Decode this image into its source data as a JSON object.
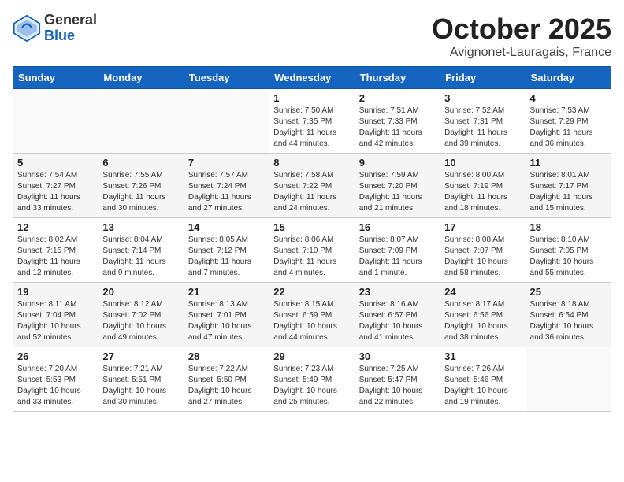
{
  "header": {
    "logo_general": "General",
    "logo_blue": "Blue",
    "month_title": "October 2025",
    "location": "Avignonet-Lauragais, France"
  },
  "weekdays": [
    "Sunday",
    "Monday",
    "Tuesday",
    "Wednesday",
    "Thursday",
    "Friday",
    "Saturday"
  ],
  "weeks": [
    [
      {
        "day": "",
        "content": ""
      },
      {
        "day": "",
        "content": ""
      },
      {
        "day": "",
        "content": ""
      },
      {
        "day": "1",
        "content": "Sunrise: 7:50 AM\nSunset: 7:35 PM\nDaylight: 11 hours and 44 minutes."
      },
      {
        "day": "2",
        "content": "Sunrise: 7:51 AM\nSunset: 7:33 PM\nDaylight: 11 hours and 42 minutes."
      },
      {
        "day": "3",
        "content": "Sunrise: 7:52 AM\nSunset: 7:31 PM\nDaylight: 11 hours and 39 minutes."
      },
      {
        "day": "4",
        "content": "Sunrise: 7:53 AM\nSunset: 7:29 PM\nDaylight: 11 hours and 36 minutes."
      }
    ],
    [
      {
        "day": "5",
        "content": "Sunrise: 7:54 AM\nSunset: 7:27 PM\nDaylight: 11 hours and 33 minutes."
      },
      {
        "day": "6",
        "content": "Sunrise: 7:55 AM\nSunset: 7:26 PM\nDaylight: 11 hours and 30 minutes."
      },
      {
        "day": "7",
        "content": "Sunrise: 7:57 AM\nSunset: 7:24 PM\nDaylight: 11 hours and 27 minutes."
      },
      {
        "day": "8",
        "content": "Sunrise: 7:58 AM\nSunset: 7:22 PM\nDaylight: 11 hours and 24 minutes."
      },
      {
        "day": "9",
        "content": "Sunrise: 7:59 AM\nSunset: 7:20 PM\nDaylight: 11 hours and 21 minutes."
      },
      {
        "day": "10",
        "content": "Sunrise: 8:00 AM\nSunset: 7:19 PM\nDaylight: 11 hours and 18 minutes."
      },
      {
        "day": "11",
        "content": "Sunrise: 8:01 AM\nSunset: 7:17 PM\nDaylight: 11 hours and 15 minutes."
      }
    ],
    [
      {
        "day": "12",
        "content": "Sunrise: 8:02 AM\nSunset: 7:15 PM\nDaylight: 11 hours and 12 minutes."
      },
      {
        "day": "13",
        "content": "Sunrise: 8:04 AM\nSunset: 7:14 PM\nDaylight: 11 hours and 9 minutes."
      },
      {
        "day": "14",
        "content": "Sunrise: 8:05 AM\nSunset: 7:12 PM\nDaylight: 11 hours and 7 minutes."
      },
      {
        "day": "15",
        "content": "Sunrise: 8:06 AM\nSunset: 7:10 PM\nDaylight: 11 hours and 4 minutes."
      },
      {
        "day": "16",
        "content": "Sunrise: 8:07 AM\nSunset: 7:09 PM\nDaylight: 11 hours and 1 minute."
      },
      {
        "day": "17",
        "content": "Sunrise: 8:08 AM\nSunset: 7:07 PM\nDaylight: 10 hours and 58 minutes."
      },
      {
        "day": "18",
        "content": "Sunrise: 8:10 AM\nSunset: 7:05 PM\nDaylight: 10 hours and 55 minutes."
      }
    ],
    [
      {
        "day": "19",
        "content": "Sunrise: 8:11 AM\nSunset: 7:04 PM\nDaylight: 10 hours and 52 minutes."
      },
      {
        "day": "20",
        "content": "Sunrise: 8:12 AM\nSunset: 7:02 PM\nDaylight: 10 hours and 49 minutes."
      },
      {
        "day": "21",
        "content": "Sunrise: 8:13 AM\nSunset: 7:01 PM\nDaylight: 10 hours and 47 minutes."
      },
      {
        "day": "22",
        "content": "Sunrise: 8:15 AM\nSunset: 6:59 PM\nDaylight: 10 hours and 44 minutes."
      },
      {
        "day": "23",
        "content": "Sunrise: 8:16 AM\nSunset: 6:57 PM\nDaylight: 10 hours and 41 minutes."
      },
      {
        "day": "24",
        "content": "Sunrise: 8:17 AM\nSunset: 6:56 PM\nDaylight: 10 hours and 38 minutes."
      },
      {
        "day": "25",
        "content": "Sunrise: 8:18 AM\nSunset: 6:54 PM\nDaylight: 10 hours and 36 minutes."
      }
    ],
    [
      {
        "day": "26",
        "content": "Sunrise: 7:20 AM\nSunset: 5:53 PM\nDaylight: 10 hours and 33 minutes."
      },
      {
        "day": "27",
        "content": "Sunrise: 7:21 AM\nSunset: 5:51 PM\nDaylight: 10 hours and 30 minutes."
      },
      {
        "day": "28",
        "content": "Sunrise: 7:22 AM\nSunset: 5:50 PM\nDaylight: 10 hours and 27 minutes."
      },
      {
        "day": "29",
        "content": "Sunrise: 7:23 AM\nSunset: 5:49 PM\nDaylight: 10 hours and 25 minutes."
      },
      {
        "day": "30",
        "content": "Sunrise: 7:25 AM\nSunset: 5:47 PM\nDaylight: 10 hours and 22 minutes."
      },
      {
        "day": "31",
        "content": "Sunrise: 7:26 AM\nSunset: 5:46 PM\nDaylight: 10 hours and 19 minutes."
      },
      {
        "day": "",
        "content": ""
      }
    ]
  ]
}
